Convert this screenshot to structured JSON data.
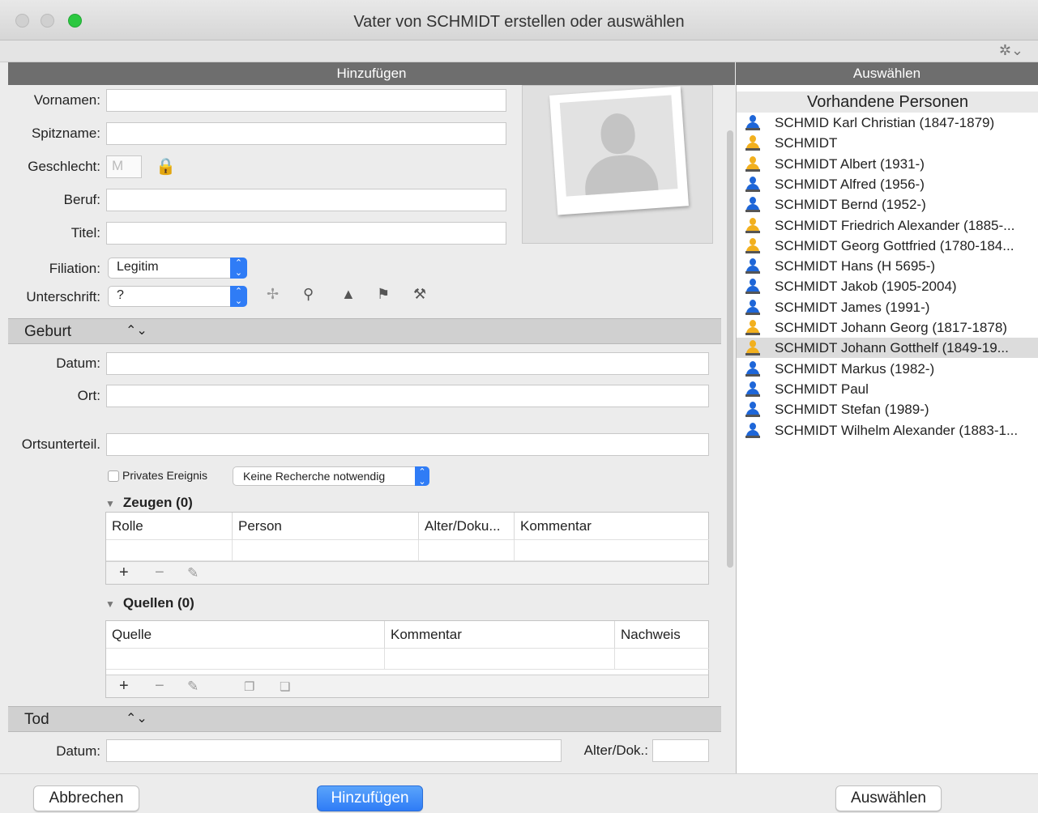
{
  "window": {
    "title": "Vater von SCHMIDT erstellen oder auswählen"
  },
  "panels": {
    "add_header": "Hinzufügen",
    "select_header": "Auswählen"
  },
  "form": {
    "vornamen_label": "Vornamen:",
    "spitzname_label": "Spitzname:",
    "geschlecht_label": "Geschlecht:",
    "geschlecht_placeholder": "M",
    "beruf_label": "Beruf:",
    "titel_label": "Titel:",
    "filiation_label": "Filiation:",
    "filiation_value": "Legitim",
    "unterschrift_label": "Unterschrift:",
    "unterschrift_value": "?"
  },
  "geburt": {
    "section_title": "Geburt",
    "datum_label": "Datum:",
    "ort_label": "Ort:",
    "ortsunterteil_label": "Ortsunterteil.",
    "privat_label": "Privates Ereignis",
    "recherche_value": "Keine Recherche notwendig",
    "zeugen": {
      "title": "Zeugen (0)",
      "columns": [
        "Rolle",
        "Person",
        "Alter/Doku...",
        "Kommentar"
      ]
    },
    "quellen": {
      "title": "Quellen (0)",
      "columns": [
        "Quelle",
        "Kommentar",
        "Nachweis"
      ]
    }
  },
  "tod": {
    "section_title": "Tod",
    "datum_label": "Datum:",
    "alter_label": "Alter/Dok.:"
  },
  "list": {
    "title": "Vorhandene Personen",
    "persons": [
      {
        "name": "SCHMID Karl Christian (1847-1879)",
        "icon": "blue"
      },
      {
        "name": "SCHMIDT",
        "icon": "yellow"
      },
      {
        "name": "SCHMIDT Albert (1931-)",
        "icon": "yellow"
      },
      {
        "name": "SCHMIDT Alfred (1956-)",
        "icon": "blue"
      },
      {
        "name": "SCHMIDT Bernd (1952-)",
        "icon": "blue"
      },
      {
        "name": "SCHMIDT Friedrich Alexander (1885-...",
        "icon": "yellow"
      },
      {
        "name": "SCHMIDT Georg Gottfried (1780-184...",
        "icon": "yellow"
      },
      {
        "name": "SCHMIDT Hans (H 5695-)",
        "icon": "blue"
      },
      {
        "name": "SCHMIDT Jakob (1905-2004)",
        "icon": "blue"
      },
      {
        "name": "SCHMIDT James (1991-)",
        "icon": "blue"
      },
      {
        "name": "SCHMIDT Johann Georg (1817-1878)",
        "icon": "yellow"
      },
      {
        "name": "SCHMIDT Johann Gotthelf (1849-19...",
        "icon": "yellow",
        "selected": true
      },
      {
        "name": "SCHMIDT Markus (1982-)",
        "icon": "blue"
      },
      {
        "name": "SCHMIDT Paul",
        "icon": "blue"
      },
      {
        "name": "SCHMIDT Stefan (1989-)",
        "icon": "blue"
      },
      {
        "name": "SCHMIDT Wilhelm Alexander (1883-1...",
        "icon": "blue"
      }
    ]
  },
  "buttons": {
    "cancel": "Abbrechen",
    "add": "Hinzufügen",
    "select": "Auswählen"
  },
  "colors": {
    "accent": "#2f7cf6",
    "male_icon": "#1e66d8",
    "female_icon": "#f2b01e"
  }
}
